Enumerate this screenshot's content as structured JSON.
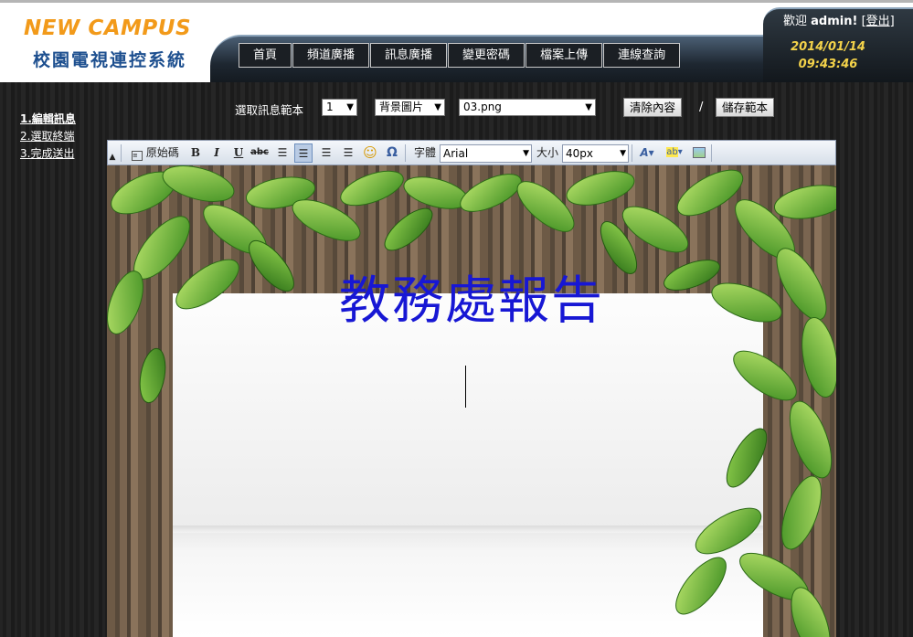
{
  "header": {
    "logo_en": "NEW CAMPUS",
    "logo_zh": "校園電視連控系統",
    "welcome_prefix": "歡迎",
    "username": "admin!",
    "logout_open": "[",
    "logout_label": "登出",
    "logout_close": "]",
    "date": "2014/01/14",
    "time": "09:43:46"
  },
  "menu": [
    "首頁",
    "頻道廣播",
    "訊息廣播",
    "變更密碼",
    "檔案上傳",
    "連線查詢"
  ],
  "steps": [
    "1.編輯訊息",
    "2.選取終端",
    "3.完成送出"
  ],
  "controls": {
    "template_label": "選取訊息範本",
    "template_value": "1",
    "bg_mode_value": "背景圖片",
    "bg_file_value": "03.png",
    "clear_button": "清除內容",
    "separator": "/",
    "save_button": "儲存範本"
  },
  "toolbar": {
    "source_label": "原始碼",
    "font_label": "字體",
    "font_value": "Arial",
    "size_label": "大小",
    "size_value": "40px"
  },
  "editor": {
    "title": "教務處報告"
  },
  "colors": {
    "accent_orange": "#f29a1a",
    "logo_blue": "#1d4f8f",
    "clock_yellow": "#f4d34a",
    "title_blue": "#1717d4"
  },
  "icons": [
    "collapse-icon",
    "source-icon",
    "bold-icon",
    "italic-icon",
    "underline-icon",
    "strikethrough-icon",
    "align-left-icon",
    "align-center-icon",
    "align-right-icon",
    "align-justify-icon",
    "emoticon-icon",
    "special-char-icon",
    "font-color-icon",
    "highlight-icon",
    "image-icon"
  ]
}
